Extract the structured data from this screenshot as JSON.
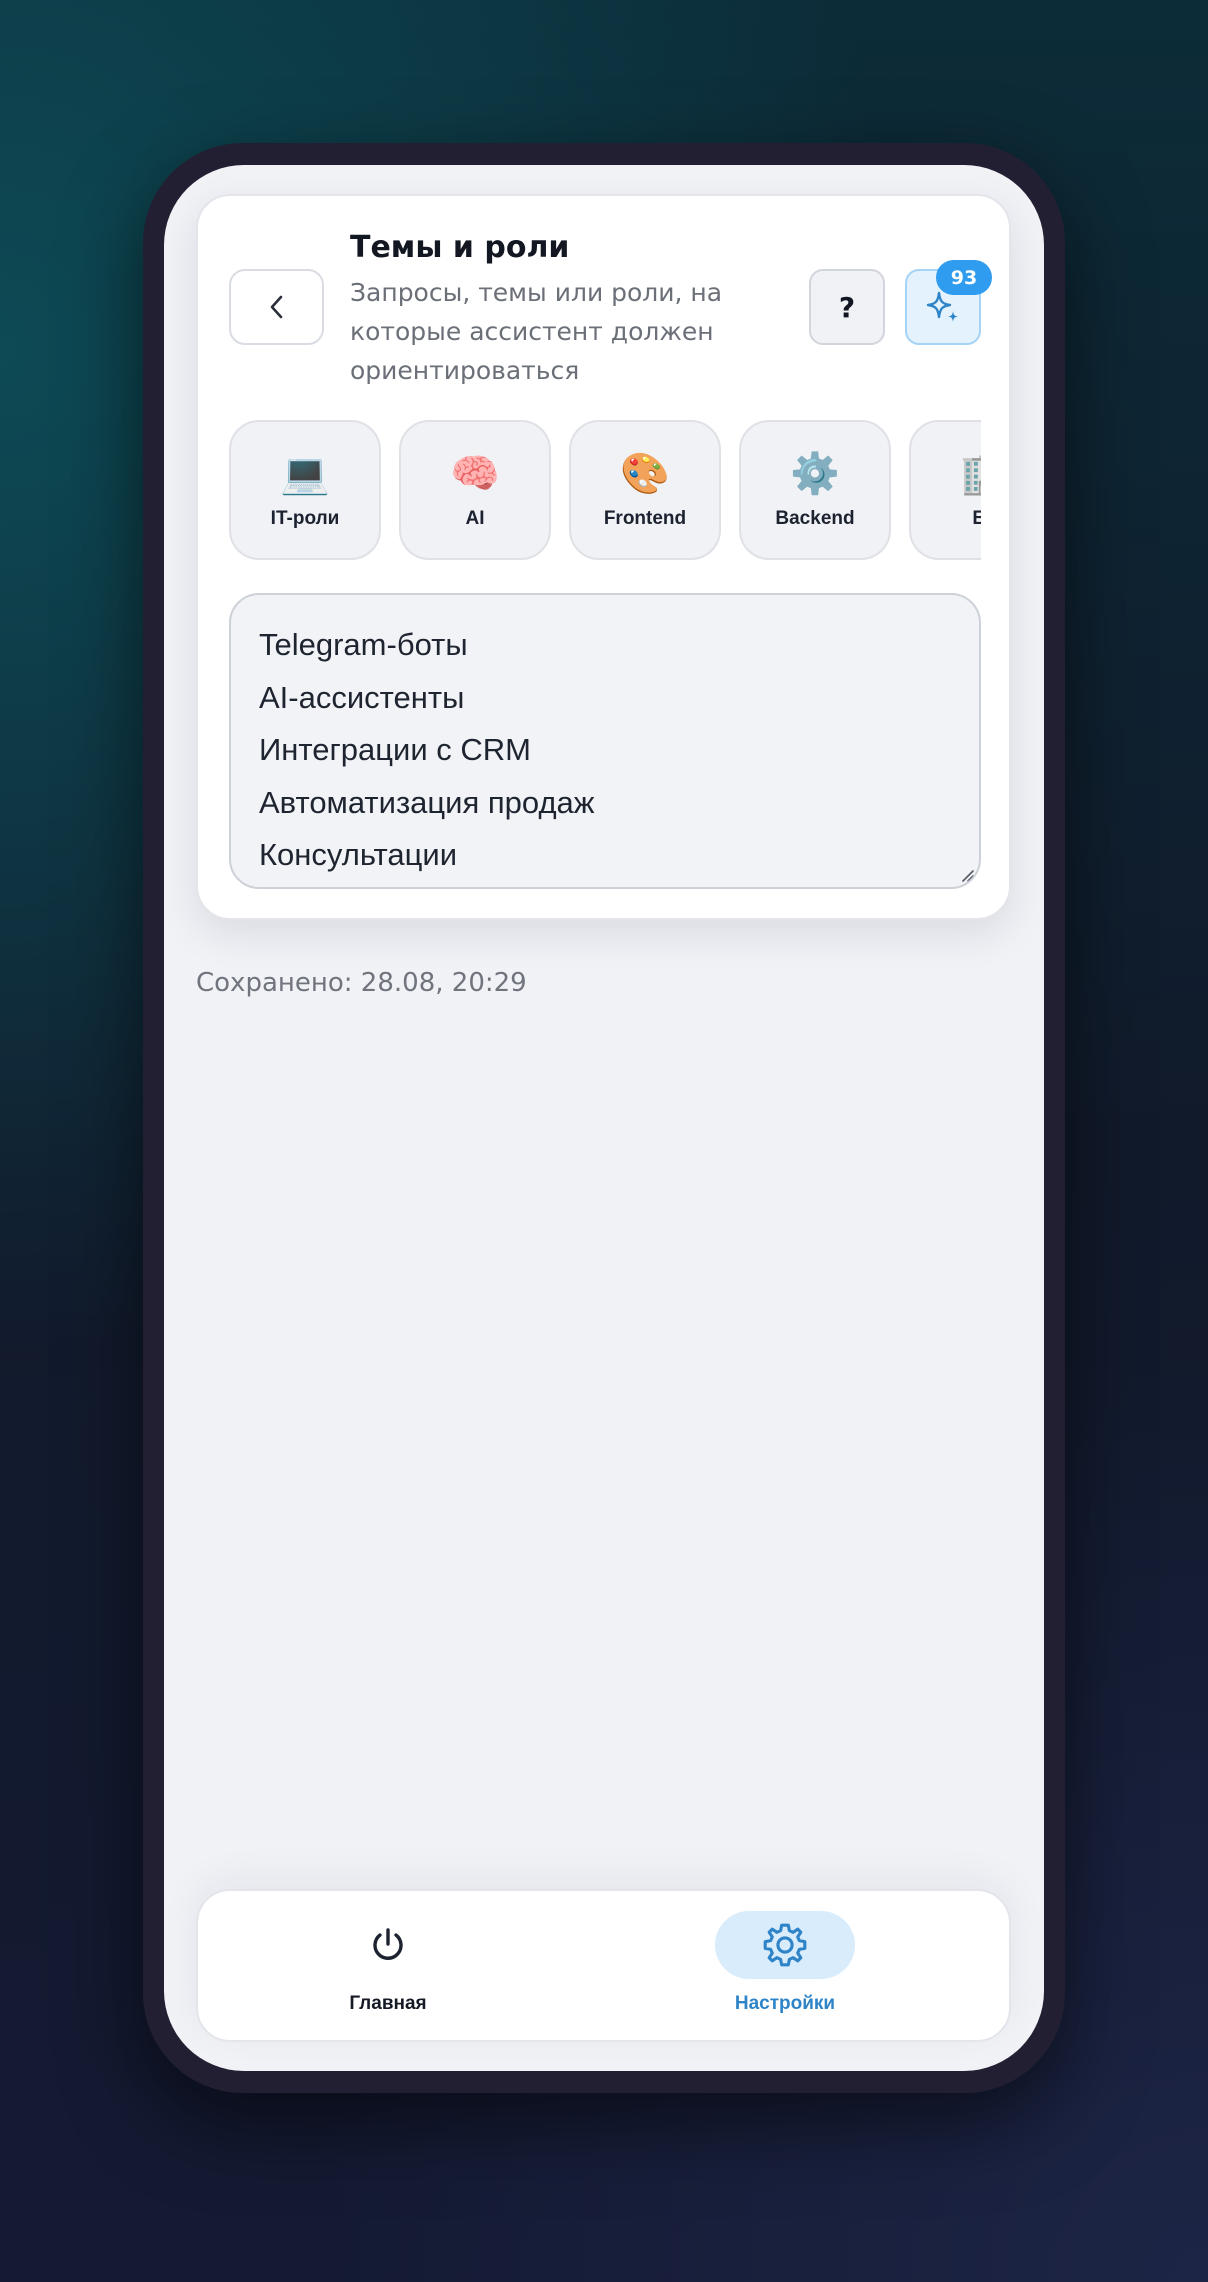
{
  "header": {
    "title": "Темы и роли",
    "subtitle": "Запросы, темы или роли, на которые ассистент должен ориентироваться",
    "help_label": "?",
    "ai_badge_count": "93"
  },
  "chips": [
    {
      "icon": "💻",
      "label": "IT-роли"
    },
    {
      "icon": "🧠",
      "label": "AI"
    },
    {
      "icon": "🎨",
      "label": "Frontend"
    },
    {
      "icon": "⚙️",
      "label": "Backend"
    },
    {
      "icon": "🏢",
      "label": "Би"
    }
  ],
  "topics": {
    "lines": [
      "Telegram-боты",
      "AI-ассистенты",
      "Интеграции с CRM",
      "Автоматизация продаж",
      "Консультации"
    ]
  },
  "status": {
    "saved": "Сохранено: 28.08, 20:29"
  },
  "tabbar": {
    "home_label": "Главная",
    "settings_label": "Настройки",
    "active": "settings"
  },
  "colors": {
    "accent": "#2f9cf0",
    "active_tab_text": "#2f84c8",
    "active_tab_bg": "#d8ecfb"
  }
}
